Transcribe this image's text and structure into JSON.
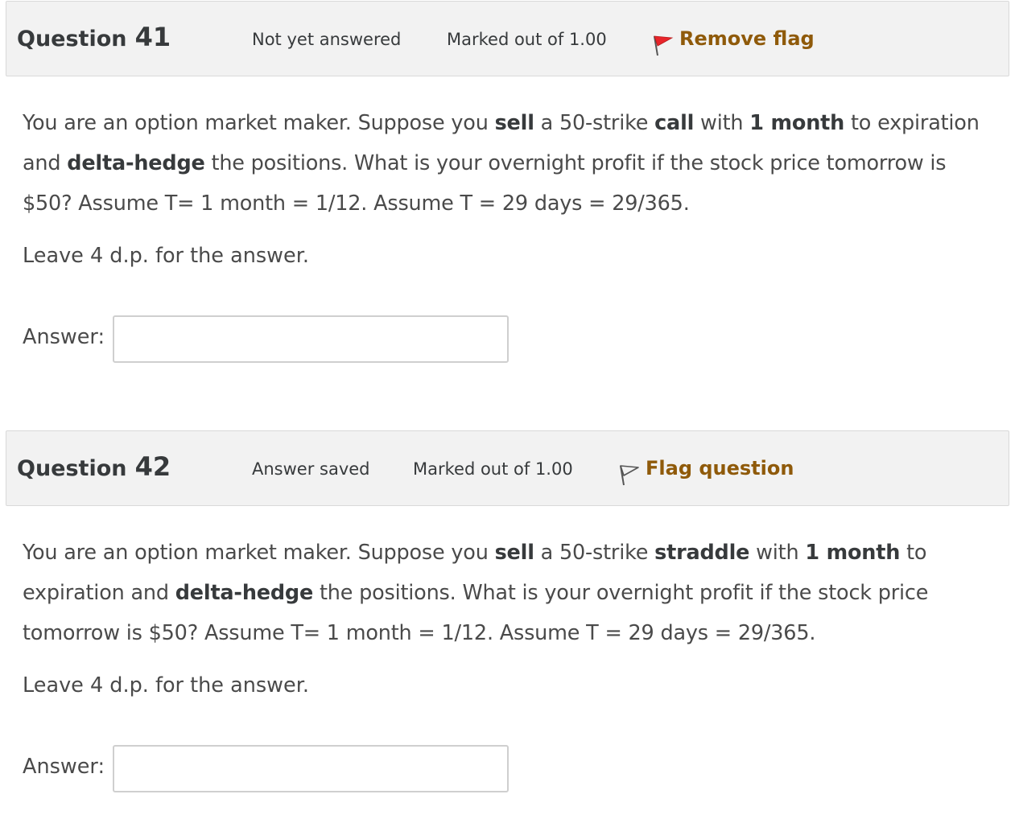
{
  "questions": [
    {
      "title_word": "Question",
      "number": "41",
      "state": "Not yet answered",
      "grade": "Marked out of 1.00",
      "flag_label": "Remove flag",
      "flag_icon": "flag-filled-red-icon",
      "text": {
        "p1": "You are an option market maker. Suppose you ",
        "b1": "sell",
        "p2": " a 50-strike ",
        "b2": "call",
        "p3": " with ",
        "b3": "1 month",
        "p4": " to expiration and ",
        "b4": "delta-hedge",
        "p5": " the positions. What is your overnight profit if the stock price tomorrow is $50? Assume T= 1 month = 1/12. Assume T = 29 days = 29/365."
      },
      "note": "Leave 4 d.p. for the answer.",
      "answer_label": "Answer:",
      "answer_value": ""
    },
    {
      "title_word": "Question",
      "number": "42",
      "state": "Answer saved",
      "grade": "Marked out of 1.00",
      "flag_label": "Flag question",
      "flag_icon": "flag-outline-icon",
      "text": {
        "p1": "You are an option market maker. Suppose you ",
        "b1": "sell",
        "p2": " a 50-strike ",
        "b2": "straddle",
        "p3": " with ",
        "b3": "1 month",
        "p4": " to expiration and ",
        "b4": "delta-hedge",
        "p5": " the positions. What is your overnight profit if the stock price tomorrow is $50? Assume T= 1 month = 1/12. Assume T = 29 days = 29/365."
      },
      "note": "Leave 4 d.p. for the answer.",
      "answer_label": "Answer:",
      "answer_value": ""
    }
  ],
  "colors": {
    "info_bg": "#f2f2f2",
    "flag_link": "#8f5a0a",
    "flag_red": "#e8252b"
  }
}
